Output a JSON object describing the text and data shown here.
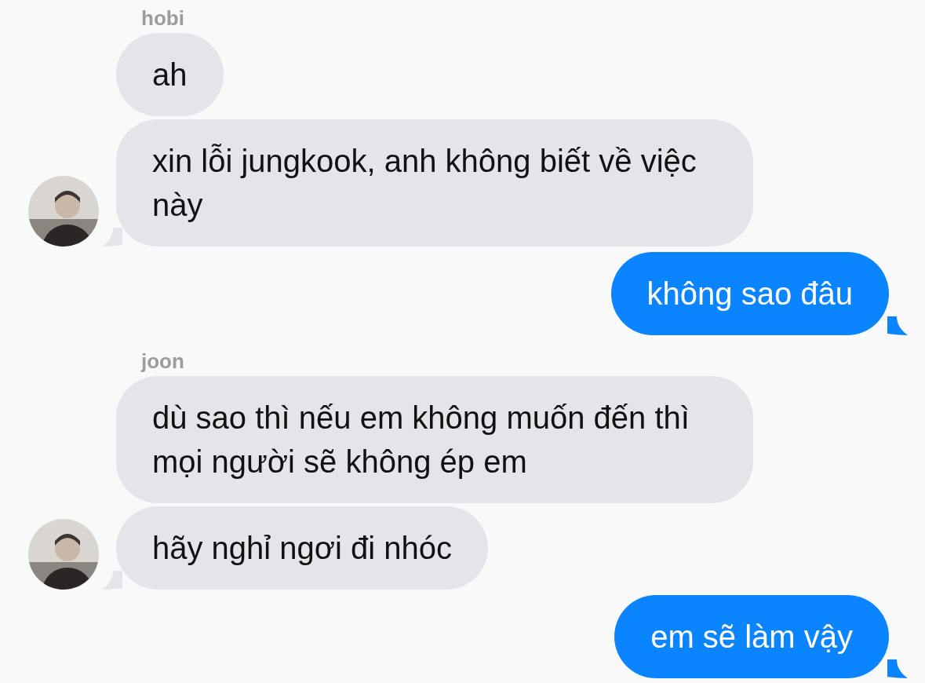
{
  "messages": [
    {
      "kind": "name",
      "text": "hobi"
    },
    {
      "kind": "incoming",
      "text": "ah",
      "avatar": false,
      "tail": false
    },
    {
      "kind": "incoming",
      "text": "xin lỗi jungkook, anh không biết về việc này",
      "avatar": true,
      "tail": true
    },
    {
      "kind": "outgoing",
      "text": "không sao đâu",
      "tail": true
    },
    {
      "kind": "name",
      "text": "joon"
    },
    {
      "kind": "incoming",
      "text": "dù sao thì nếu em không muốn đến thì mọi người sẽ không ép em",
      "avatar": false,
      "tail": false
    },
    {
      "kind": "incoming",
      "text": "hãy nghỉ ngơi đi nhóc",
      "avatar": true,
      "tail": true
    },
    {
      "kind": "outgoing",
      "text": "em sẽ làm vậy",
      "tail": true
    }
  ]
}
